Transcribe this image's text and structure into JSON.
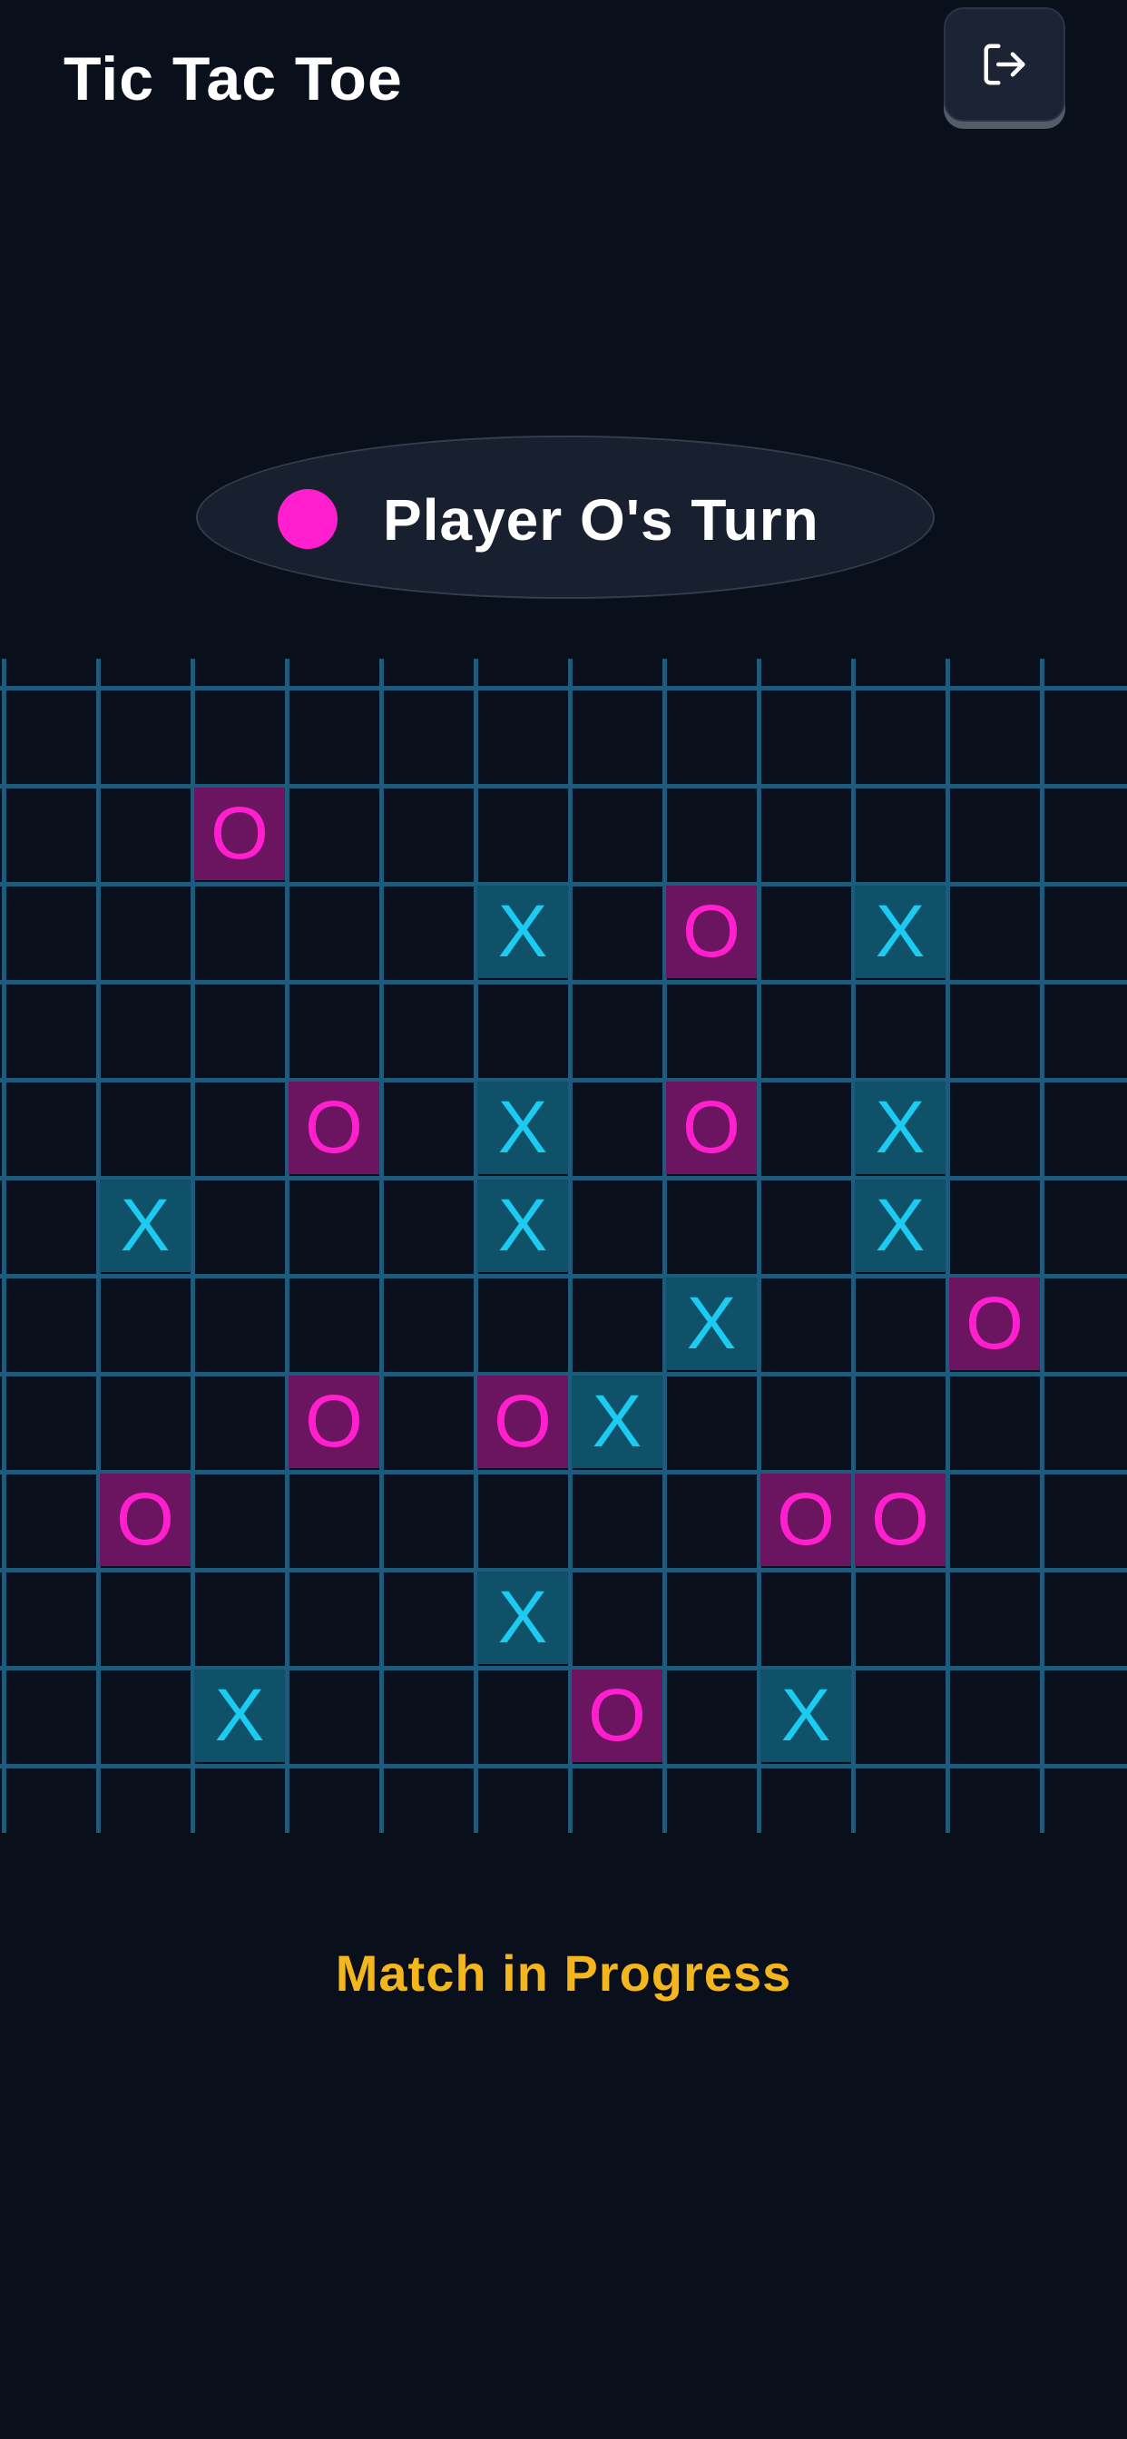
{
  "header": {
    "title": "Tic Tac Toe",
    "exit_icon": "logout-icon"
  },
  "turn": {
    "label": "Player O's Turn",
    "player": "O"
  },
  "board": {
    "columns": 12,
    "rows": 12,
    "marks": [
      {
        "row": 1,
        "col": 2,
        "mark": "O"
      },
      {
        "row": 2,
        "col": 5,
        "mark": "X"
      },
      {
        "row": 2,
        "col": 7,
        "mark": "O"
      },
      {
        "row": 2,
        "col": 9,
        "mark": "X"
      },
      {
        "row": 4,
        "col": 3,
        "mark": "O"
      },
      {
        "row": 4,
        "col": 5,
        "mark": "X"
      },
      {
        "row": 4,
        "col": 7,
        "mark": "O"
      },
      {
        "row": 4,
        "col": 9,
        "mark": "X"
      },
      {
        "row": 5,
        "col": 1,
        "mark": "X"
      },
      {
        "row": 5,
        "col": 5,
        "mark": "X"
      },
      {
        "row": 5,
        "col": 9,
        "mark": "X"
      },
      {
        "row": 6,
        "col": 7,
        "mark": "X"
      },
      {
        "row": 6,
        "col": 10,
        "mark": "O"
      },
      {
        "row": 7,
        "col": 3,
        "mark": "O"
      },
      {
        "row": 7,
        "col": 5,
        "mark": "O"
      },
      {
        "row": 7,
        "col": 6,
        "mark": "X"
      },
      {
        "row": 8,
        "col": 1,
        "mark": "O"
      },
      {
        "row": 8,
        "col": 8,
        "mark": "O"
      },
      {
        "row": 8,
        "col": 9,
        "mark": "O"
      },
      {
        "row": 9,
        "col": 5,
        "mark": "X"
      },
      {
        "row": 10,
        "col": 2,
        "mark": "X"
      },
      {
        "row": 10,
        "col": 6,
        "mark": "O"
      },
      {
        "row": 10,
        "col": 8,
        "mark": "X"
      }
    ]
  },
  "status": {
    "label": "Match in Progress"
  },
  "colors": {
    "background": "#0a0f1c",
    "grid_line": "#1d5a7b",
    "player_x": "#1ccbf2",
    "player_x_cell": "#0e5169",
    "player_o": "#ff1fcf",
    "player_o_cell": "#6b1460",
    "status": "#f4b61d"
  }
}
